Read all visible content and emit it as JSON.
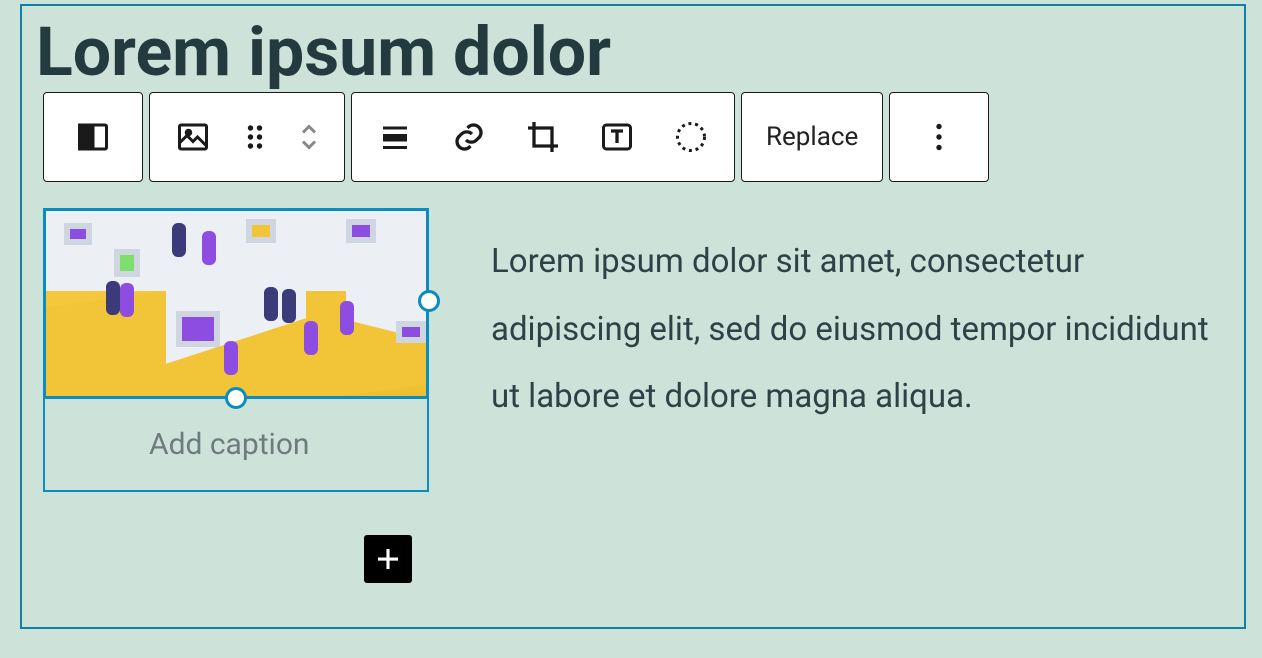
{
  "heading": "Lorem ipsum dolor",
  "toolbar": {
    "replace_label": "Replace"
  },
  "image_block": {
    "caption_placeholder": "Add caption"
  },
  "text_column": {
    "body": "Lorem ipsum dolor sit amet, consectetur adipiscing elit, sed do eiusmod tempor incididunt ut labore et dolore magna aliqua."
  }
}
